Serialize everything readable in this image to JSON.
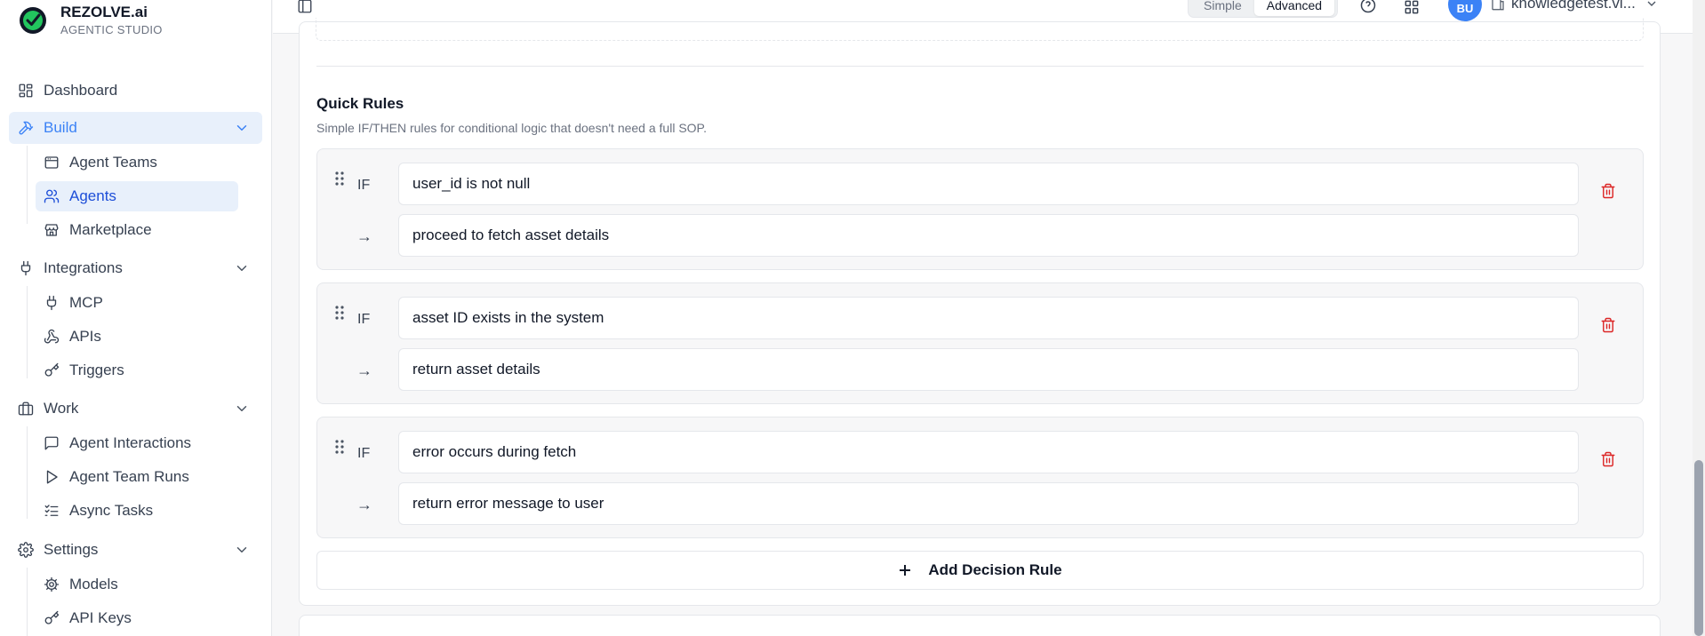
{
  "brand": {
    "name": "REZOLVE.ai",
    "subtitle": "AGENTIC STUDIO",
    "logo_color": "#16a34a"
  },
  "sidebar": {
    "items": [
      {
        "label": "Dashboard",
        "icon": "dashboard-icon"
      },
      {
        "label": "Build",
        "icon": "hammer-icon",
        "expanded": true,
        "children": [
          {
            "label": "Agent Teams",
            "icon": "browser-window-icon"
          },
          {
            "label": "Agents",
            "icon": "users-icon",
            "active": true
          },
          {
            "label": "Marketplace",
            "icon": "store-icon"
          }
        ]
      },
      {
        "label": "Integrations",
        "icon": "plug-icon",
        "expanded": true,
        "children": [
          {
            "label": "MCP",
            "icon": "plug-icon"
          },
          {
            "label": "APIs",
            "icon": "webhook-icon"
          },
          {
            "label": "Triggers",
            "icon": "key-icon"
          }
        ]
      },
      {
        "label": "Work",
        "icon": "briefcase-icon",
        "expanded": true,
        "children": [
          {
            "label": "Agent Interactions",
            "icon": "message-square-icon"
          },
          {
            "label": "Agent Team Runs",
            "icon": "play-icon"
          },
          {
            "label": "Async Tasks",
            "icon": "list-checks-icon"
          }
        ]
      },
      {
        "label": "Settings",
        "icon": "gear-icon",
        "expanded": true,
        "children": [
          {
            "label": "Models",
            "icon": "cog-icon"
          },
          {
            "label": "API Keys",
            "icon": "key-icon"
          }
        ]
      }
    ]
  },
  "topbar": {
    "mode_simple": "Simple",
    "mode_advanced": "Advanced",
    "active_mode": "Advanced",
    "avatar_initials": "BU",
    "workspace": "knowledgetest.vi...",
    "accent": "#3b82f6"
  },
  "quick_rules": {
    "title": "Quick Rules",
    "description": "Simple IF/THEN rules for conditional logic that doesn't need a full SOP.",
    "if_label": "IF",
    "then_symbol": "→",
    "rules": [
      {
        "condition": "user_id is not null",
        "action": "proceed to fetch asset details"
      },
      {
        "condition": "asset ID exists in the system",
        "action": "return asset details"
      },
      {
        "condition": "error occurs during fetch",
        "action": "return error message to user"
      }
    ],
    "add_button": "Add Decision Rule",
    "delete_color": "#dc2626"
  }
}
